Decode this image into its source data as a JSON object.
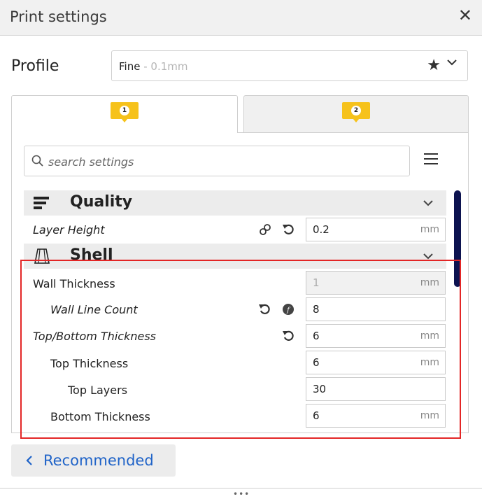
{
  "window": {
    "title": "Print settings",
    "close_glyph": "✕"
  },
  "profile": {
    "label": "Profile",
    "name": "Fine",
    "suffix": " - 0.1mm"
  },
  "tabs": [
    {
      "number": "1"
    },
    {
      "number": "2"
    }
  ],
  "search": {
    "placeholder": "search settings"
  },
  "categories": {
    "quality": "Quality",
    "shell": "Shell"
  },
  "settings": {
    "layer_height": {
      "label": "Layer Height",
      "value": "0.2",
      "unit": "mm"
    },
    "wall_thickness": {
      "label": "Wall Thickness",
      "value": "1",
      "unit": "mm"
    },
    "wall_line_count": {
      "label": "Wall Line Count",
      "value": "8"
    },
    "top_bottom_thickness": {
      "label": "Top/Bottom Thickness",
      "value": "6",
      "unit": "mm"
    },
    "top_thickness": {
      "label": "Top Thickness",
      "value": "6",
      "unit": "mm"
    },
    "top_layers": {
      "label": "Top Layers",
      "value": "30"
    },
    "bottom_thickness": {
      "label": "Bottom Thickness",
      "value": "6",
      "unit": "mm"
    }
  },
  "footer": {
    "recommended_label": "Recommended",
    "dots": "•••"
  },
  "colors": {
    "accent": "#f6c21b",
    "link": "#1f63c8",
    "scrollbar": "#0d1350",
    "highlight": "#e32626"
  }
}
